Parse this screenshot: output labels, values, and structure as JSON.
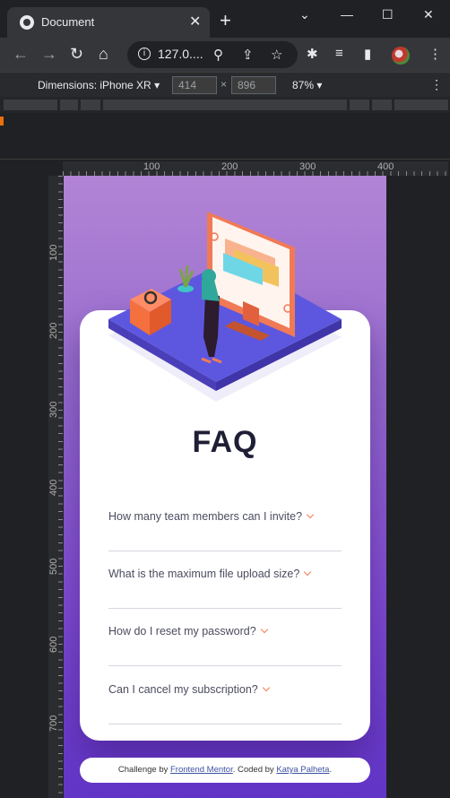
{
  "browser": {
    "tab_title": "Document",
    "url": "127.0....",
    "device_label": "Dimensions: iPhone XR",
    "width_value": "414",
    "height_value": "896",
    "times": "×",
    "zoom": "87%"
  },
  "ruler": {
    "top_ticks": [
      "100",
      "200",
      "300",
      "400"
    ],
    "left_ticks": [
      "100",
      "200",
      "300",
      "400",
      "500",
      "600",
      "700"
    ]
  },
  "faq": {
    "title": "FAQ",
    "items": [
      {
        "question": "How many team members can I invite?"
      },
      {
        "question": "What is the maximum file upload size?"
      },
      {
        "question": "How do I reset my password?"
      },
      {
        "question": "Can I cancel my subscription?"
      }
    ]
  },
  "footer": {
    "prefix": "Challenge by ",
    "link1": "Frontend Mentor",
    "middle": ". Coded by ",
    "link2": "Katya Palheta",
    "suffix": "."
  },
  "colors": {
    "accent": "#f47c57",
    "title": "#1e1f36",
    "bg_top": "#b284d6",
    "bg_bottom": "#6235c7"
  }
}
